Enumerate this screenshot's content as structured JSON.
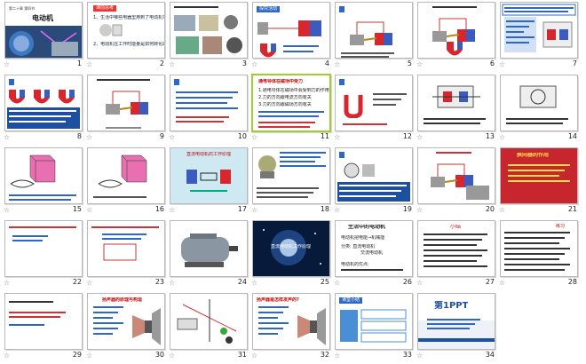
{
  "slides": [
    {
      "number": "1",
      "title": "电动机",
      "subtitle": "第二十章 第四节"
    },
    {
      "number": "2",
      "title": "课前思考"
    },
    {
      "number": "3",
      "title": ""
    },
    {
      "number": "4",
      "title": "探究活动"
    },
    {
      "number": "5",
      "title": ""
    },
    {
      "number": "6",
      "title": ""
    },
    {
      "number": "7",
      "title": ""
    },
    {
      "number": "8",
      "title": ""
    },
    {
      "number": "9",
      "title": ""
    },
    {
      "number": "10",
      "title": ""
    },
    {
      "number": "11",
      "title": "通电导体在磁场中受力"
    },
    {
      "number": "12",
      "title": ""
    },
    {
      "number": "13",
      "title": ""
    },
    {
      "number": "14",
      "title": ""
    },
    {
      "number": "15",
      "title": ""
    },
    {
      "number": "16",
      "title": ""
    },
    {
      "number": "17",
      "title": "直流电动机的工作原理"
    },
    {
      "number": "18",
      "title": ""
    },
    {
      "number": "19",
      "title": ""
    },
    {
      "number": "20",
      "title": ""
    },
    {
      "number": "21",
      "title": "换向器的作用"
    },
    {
      "number": "22",
      "title": ""
    },
    {
      "number": "23",
      "title": ""
    },
    {
      "number": "24",
      "title": ""
    },
    {
      "number": "25",
      "title": "直流电动机工作原理"
    },
    {
      "number": "26",
      "title": "生活中的电动机"
    },
    {
      "number": "27",
      "title": "小结"
    },
    {
      "number": "28",
      "title": "练习"
    },
    {
      "number": "29",
      "title": ""
    },
    {
      "number": "30",
      "title": "扬声器的原理与构造"
    },
    {
      "number": "31",
      "title": ""
    },
    {
      "number": "32",
      "title": "扬声器是怎样发声的?"
    },
    {
      "number": "33",
      "title": "课堂小结"
    },
    {
      "number": "34",
      "title": "第1PPT"
    }
  ],
  "texts": {
    "s2_l1": "1、生活中哪些电器里用到了电动机?",
    "s2_l2": "2、电动机在工作时能量是如何转化的?",
    "s11_l1": "1.通电导体在磁场中会受到力的作用",
    "s11_l2": "2.力的方向跟电流方向有关",
    "s11_l3": "3.力的方向跟磁场方向有关",
    "s26_l1": "电动机把电能→机械能",
    "s26_l2": "分类: 直流电动机",
    "s26_l3": "交流电动机",
    "s26_l4": "电动机的优点:",
    "s30_label": "扬声器",
    "s33_box1": "",
    "s34_sub": "www.1ppt.com"
  },
  "selected_slide": "11",
  "star_symbol": "☆"
}
